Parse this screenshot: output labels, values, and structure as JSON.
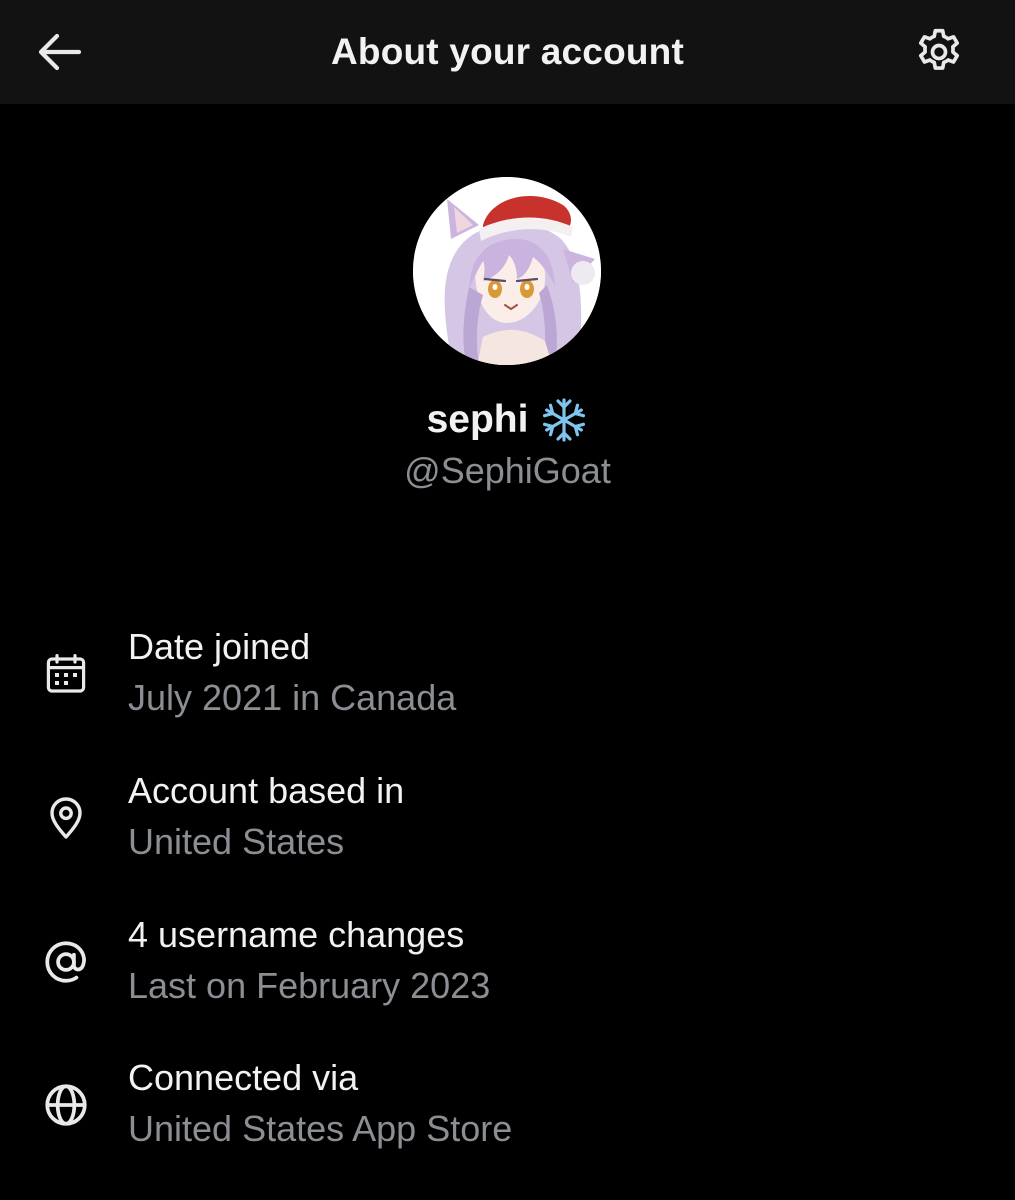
{
  "header": {
    "title": "About your account",
    "back_icon": "arrow-left-icon",
    "settings_icon": "gear-icon"
  },
  "profile": {
    "display_name": "sephi",
    "name_emoji": "snowflake-icon",
    "handle": "@SephiGoat"
  },
  "info": [
    {
      "icon": "calendar-icon",
      "title": "Date joined",
      "value": "July 2021 in Canada"
    },
    {
      "icon": "location-pin-icon",
      "title": "Account based in",
      "value": "United States"
    },
    {
      "icon": "at-sign-icon",
      "title": "4 username changes",
      "value": "Last on February 2023"
    },
    {
      "icon": "globe-icon",
      "title": "Connected via",
      "value": "United States App Store"
    }
  ],
  "colors": {
    "background": "#000000",
    "topbar": "#121212",
    "primary_text": "#f2f2f2",
    "secondary_text": "#8b8f94"
  }
}
